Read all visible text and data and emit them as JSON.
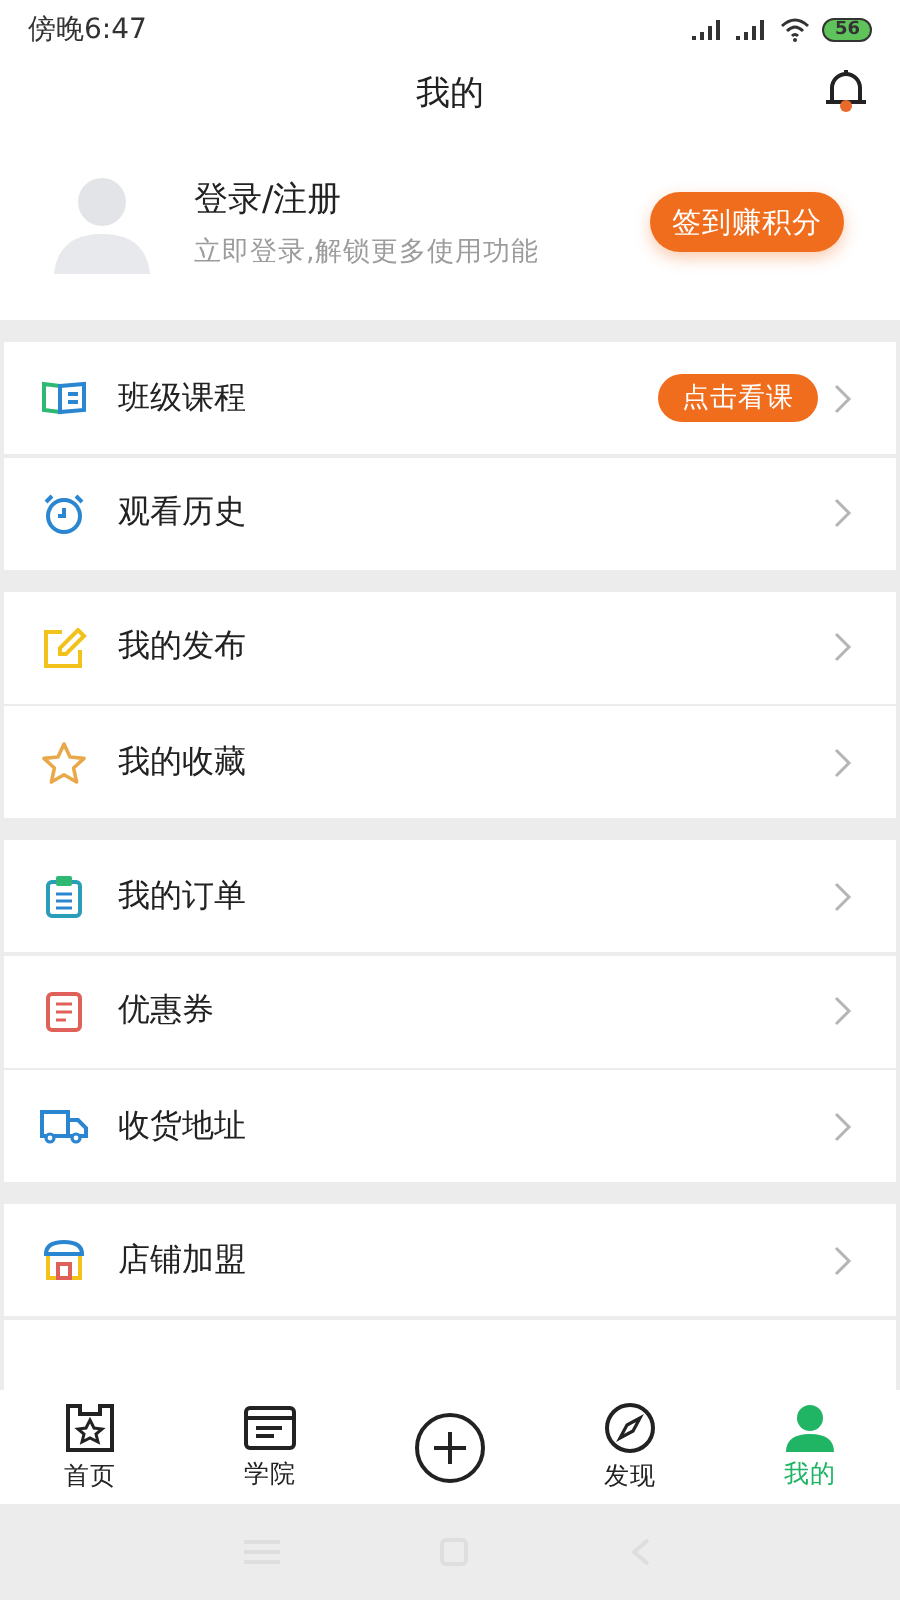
{
  "status_bar": {
    "time": "傍晚6:47",
    "battery": "56"
  },
  "header": {
    "title": "我的"
  },
  "profile": {
    "name": "登录/注册",
    "subtitle": "立即登录,解锁更多使用功能",
    "checkin_button": "签到赚积分"
  },
  "menu_groups": [
    {
      "items": [
        {
          "kind": "book",
          "label": "班级课程",
          "badge": "点击看课"
        },
        {
          "kind": "clock",
          "label": "观看历史"
        }
      ]
    },
    {
      "items": [
        {
          "kind": "edit",
          "label": "我的发布"
        },
        {
          "kind": "star",
          "label": "我的收藏"
        }
      ]
    },
    {
      "items": [
        {
          "kind": "clipboard",
          "label": "我的订单"
        },
        {
          "kind": "coupon",
          "label": "优惠券"
        },
        {
          "kind": "truck",
          "label": "收货地址"
        }
      ]
    },
    {
      "items": [
        {
          "kind": "shop",
          "label": "店铺加盟"
        },
        {
          "kind": "partial"
        }
      ]
    }
  ],
  "tab_bar": [
    {
      "kind": "home",
      "label": "首页",
      "selected": false
    },
    {
      "kind": "academy",
      "label": "学院",
      "selected": false
    },
    {
      "kind": "plus",
      "selected": false
    },
    {
      "kind": "compass",
      "label": "发现",
      "selected": false
    },
    {
      "kind": "person",
      "label": "我的",
      "selected": true
    }
  ]
}
